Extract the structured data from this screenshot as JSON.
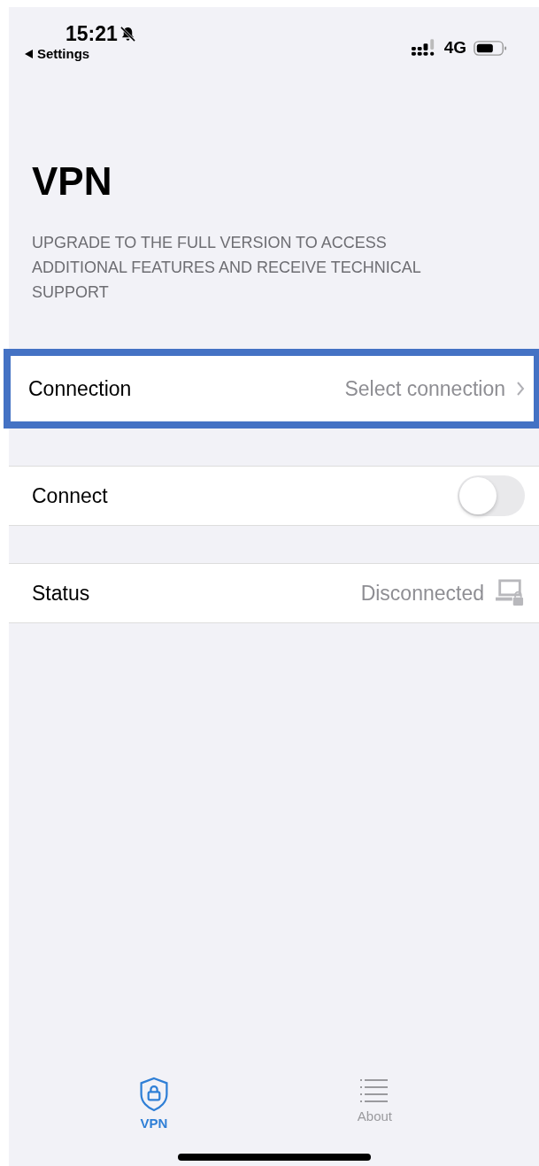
{
  "status_bar": {
    "time": "15:21",
    "back_label": "Settings",
    "network": "4G",
    "silent": true
  },
  "title": "VPN",
  "description": "UPGRADE TO THE FULL VERSION TO ACCESS ADDITIONAL FEATURES AND RECEIVE TECHNICAL SUPPORT",
  "rows": [
    {
      "kind": "link",
      "label": "Connection",
      "value": "Select connection",
      "highlighted": true
    },
    {
      "kind": "toggle",
      "label": "Connect",
      "on": false,
      "highlighted": false
    },
    {
      "kind": "status",
      "label": "Status",
      "value": "Disconnected",
      "highlighted": false
    }
  ],
  "tabs": [
    {
      "label": "VPN",
      "kind": "shield",
      "selected": true
    },
    {
      "label": "About",
      "kind": "list",
      "selected": false
    }
  ]
}
